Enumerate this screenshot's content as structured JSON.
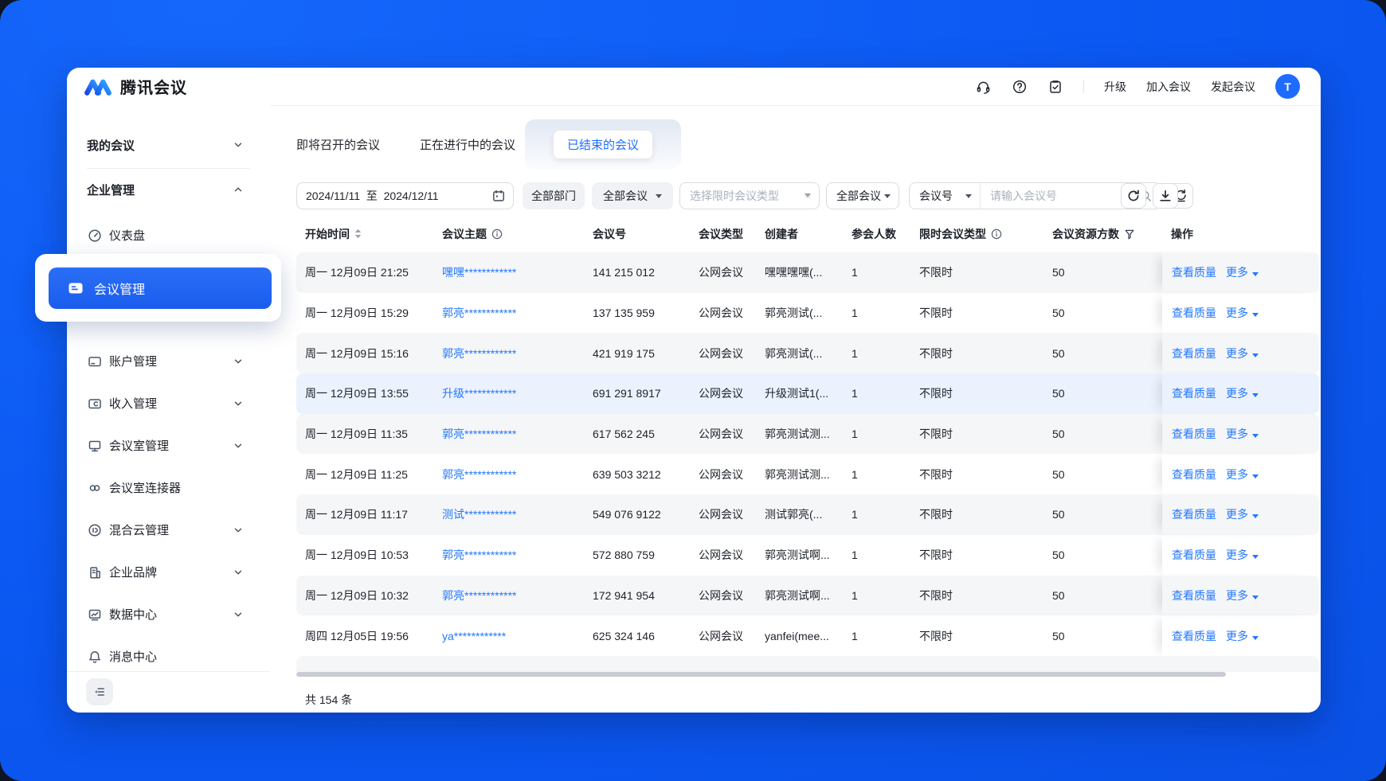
{
  "colors": {
    "brand_blue": "#0b58f2",
    "accent": "#1f6fff",
    "link": "#2277ff",
    "active_item": "#1e63f0",
    "zebra_row": "#f5f6f8",
    "hover_row": "#ecf2fd"
  },
  "topbar": {
    "title": "腾讯会议",
    "icons": [
      "headset-icon",
      "help-icon",
      "task-icon"
    ],
    "links": {
      "upgrade": "升级",
      "join": "加入会议",
      "start": "发起会议"
    },
    "avatar": "T"
  },
  "sidebar": {
    "groups": [
      {
        "label": "我的会议",
        "chevron": "down"
      },
      {
        "label": "企业管理",
        "chevron": "up"
      }
    ],
    "items": [
      {
        "id": "dashboard",
        "icon": "dashboard",
        "label": "仪表盘",
        "chevron": false
      },
      {
        "id": "meeting-manage",
        "icon": "meeting",
        "label": "会议管理",
        "active": true
      },
      {
        "id": "account-manage",
        "icon": "account",
        "label": "账户管理",
        "chevron": true
      },
      {
        "id": "income-manage",
        "icon": "income",
        "label": "收入管理",
        "chevron": true
      },
      {
        "id": "rooms-manage",
        "icon": "rooms",
        "label": "会议室管理",
        "chevron": true
      },
      {
        "id": "rooms-connector",
        "icon": "connector",
        "label": "会议室连接器",
        "chevron": false
      },
      {
        "id": "hybrid-cloud",
        "icon": "hybrid",
        "label": "混合云管理",
        "chevron": true
      },
      {
        "id": "enterprise-brand",
        "icon": "brand",
        "label": "企业品牌",
        "chevron": true
      },
      {
        "id": "data-center",
        "icon": "data",
        "label": "数据中心",
        "chevron": true
      },
      {
        "id": "message-center",
        "icon": "message",
        "label": "消息中心",
        "chevron": false
      }
    ]
  },
  "tabs": [
    {
      "label": "即将召开的会议",
      "active": false
    },
    {
      "label": "正在进行中的会议",
      "active": false
    },
    {
      "label": "已结束的会议",
      "active": true
    }
  ],
  "filters": {
    "date_start": "2024/11/11",
    "date_separator": "至",
    "date_end": "2024/12/11",
    "department": "全部部门",
    "meeting_scope": "全部会议",
    "limited_type_placeholder": "选择限时会议类型",
    "meeting_filter": "全部会议",
    "search_field": "会议号",
    "search_placeholder": "请输入会议号",
    "search_value": ""
  },
  "table": {
    "columns": [
      {
        "key": "time",
        "label": "开始时间",
        "icon": "sort"
      },
      {
        "key": "topic",
        "label": "会议主题",
        "icon": "info"
      },
      {
        "key": "number",
        "label": "会议号",
        "icon": ""
      },
      {
        "key": "type",
        "label": "会议类型",
        "icon": ""
      },
      {
        "key": "creator",
        "label": "创建者",
        "icon": ""
      },
      {
        "key": "participants",
        "label": "参会人数",
        "icon": ""
      },
      {
        "key": "limited",
        "label": "限时会议类型",
        "icon": "info"
      },
      {
        "key": "resources",
        "label": "会议资源方数",
        "icon": "funnel"
      },
      {
        "key": "action",
        "label": "操作",
        "icon": ""
      }
    ],
    "row_actions": {
      "quality": "查看质量",
      "more": "更多"
    },
    "rows": [
      {
        "time": "周一 12月09日 21:25",
        "topic": "嘿嘿************",
        "number": "141 215 012",
        "type": "公网会议",
        "creator": "嘿嘿嘿嘿(...",
        "participants": "1",
        "limited": "不限时",
        "resources": "50",
        "state": "normal"
      },
      {
        "time": "周一 12月09日 15:29",
        "topic": "郭亮************",
        "number": "137 135 959",
        "type": "公网会议",
        "creator": "郭亮测试(...",
        "participants": "1",
        "limited": "不限时",
        "resources": "50",
        "state": "normal"
      },
      {
        "time": "周一 12月09日 15:16",
        "topic": "郭亮************",
        "number": "421 919 175",
        "type": "公网会议",
        "creator": "郭亮测试(...",
        "participants": "1",
        "limited": "不限时",
        "resources": "50",
        "state": "normal"
      },
      {
        "time": "周一 12月09日 13:55",
        "topic": "升级************",
        "number": "691 291 8917",
        "type": "公网会议",
        "creator": "升级测试1(...",
        "participants": "1",
        "limited": "不限时",
        "resources": "50",
        "state": "hover"
      },
      {
        "time": "周一 12月09日 11:35",
        "topic": "郭亮************",
        "number": "617 562 245",
        "type": "公网会议",
        "creator": "郭亮测试测...",
        "participants": "1",
        "limited": "不限时",
        "resources": "50",
        "state": "normal"
      },
      {
        "time": "周一 12月09日 11:25",
        "topic": "郭亮************",
        "number": "639 503 3212",
        "type": "公网会议",
        "creator": "郭亮测试测...",
        "participants": "1",
        "limited": "不限时",
        "resources": "50",
        "state": "normal"
      },
      {
        "time": "周一 12月09日 11:17",
        "topic": "测试************",
        "number": "549 076 9122",
        "type": "公网会议",
        "creator": "测试郭亮(...",
        "participants": "1",
        "limited": "不限时",
        "resources": "50",
        "state": "normal"
      },
      {
        "time": "周一 12月09日 10:53",
        "topic": "郭亮************",
        "number": "572 880 759",
        "type": "公网会议",
        "creator": "郭亮测试啊...",
        "participants": "1",
        "limited": "不限时",
        "resources": "50",
        "state": "normal"
      },
      {
        "time": "周一 12月09日 10:32",
        "topic": "郭亮************",
        "number": "172 941 954",
        "type": "公网会议",
        "creator": "郭亮测试啊...",
        "participants": "1",
        "limited": "不限时",
        "resources": "50",
        "state": "normal"
      },
      {
        "time": "周四 12月05日 19:56",
        "topic": "ya************",
        "number": "625 324 146",
        "type": "公网会议",
        "creator": "yanfei(mee...",
        "participants": "1",
        "limited": "不限时",
        "resources": "50",
        "state": "normal"
      }
    ]
  },
  "footer": {
    "total": "共 154 条"
  }
}
